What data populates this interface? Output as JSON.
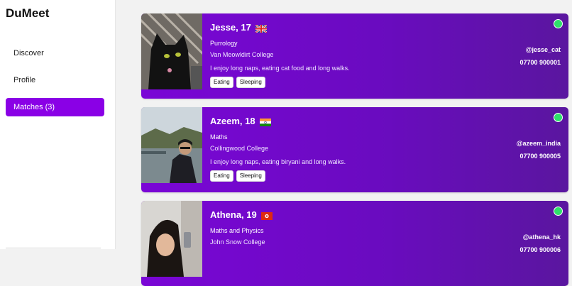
{
  "app": {
    "title": "DuMeet"
  },
  "nav": {
    "items": [
      {
        "label": "Discover"
      },
      {
        "label": "Profile"
      },
      {
        "label": "Matches (3)"
      }
    ]
  },
  "matches": [
    {
      "name_age": "Jesse, 17",
      "flag": "uk-flag",
      "course": "Purrology",
      "college": "Van Meowldirt College",
      "bio": "I enjoy long naps, eating cat food and long walks.",
      "tags": [
        "Eating",
        "Sleeping"
      ],
      "handle": "@jesse_cat",
      "phone": "07700 900001",
      "status": "online"
    },
    {
      "name_age": "Azeem, 18",
      "flag": "india-flag",
      "course": "Maths",
      "college": "Collingwood College",
      "bio": "I enjoy long naps, eating biryani and long walks.",
      "tags": [
        "Eating",
        "Sleeping"
      ],
      "handle": "@azeem_india",
      "phone": "07700 900005",
      "status": "online"
    },
    {
      "name_age": "Athena, 19",
      "flag": "hong-kong-flag",
      "course": "Maths and Physics",
      "college": "John Snow College",
      "handle": "@athena_hk",
      "phone": "07700 900006",
      "status": "online"
    }
  ],
  "colors": {
    "accent": "#8a00e6",
    "card_gradient_start": "#7a06d6",
    "card_gradient_end": "#5a169f",
    "online": "#2ee06a"
  }
}
